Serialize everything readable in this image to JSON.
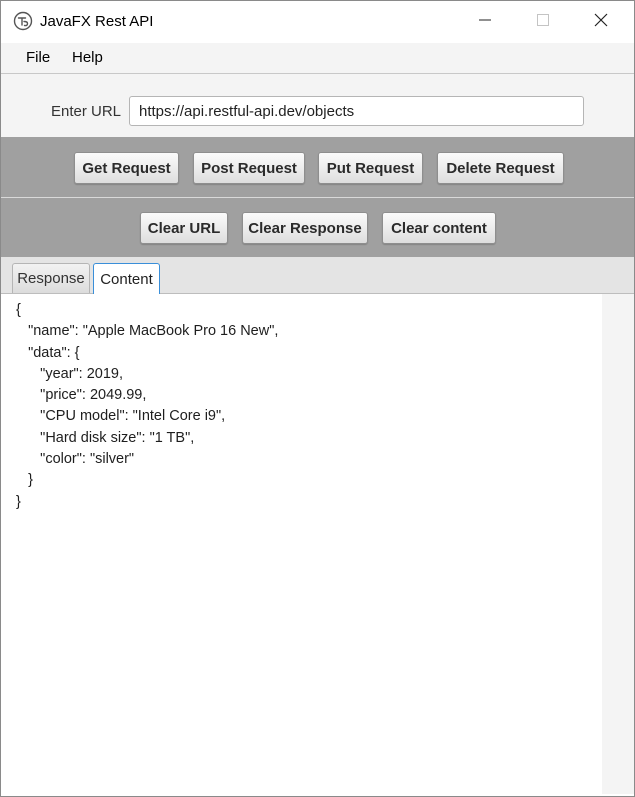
{
  "window": {
    "title": "JavaFX Rest API",
    "app_icon": "javafx-logo-icon",
    "controls": [
      "minimize-icon",
      "maximize-icon",
      "close-icon"
    ]
  },
  "menu": {
    "file": "File",
    "help": "Help"
  },
  "url_section": {
    "label": "Enter URL",
    "value": "https://api.restful-api.dev/objects"
  },
  "request_buttons": {
    "get": "Get Request",
    "post": "Post Request",
    "put": "Put Request",
    "delete": "Delete Request"
  },
  "clear_buttons": {
    "url": "Clear URL",
    "response": "Clear Response",
    "content": "Clear content"
  },
  "tabs": {
    "response": "Response",
    "content": "Content",
    "selected": "Content"
  },
  "content": {
    "text": "{\n   \"name\": \"Apple MacBook Pro 16 New\",\n   \"data\": {\n      \"year\": 2019,\n      \"price\": 2049.99,\n      \"CPU model\": \"Intel Core i9\",\n      \"Hard disk size\": \"1 TB\",\n      \"color\": \"silver\"\n   }\n}"
  },
  "colors": {
    "button_band": "#a0a0a0",
    "tab_focus": "#3a8fd9",
    "panel": "#f4f4f4"
  }
}
